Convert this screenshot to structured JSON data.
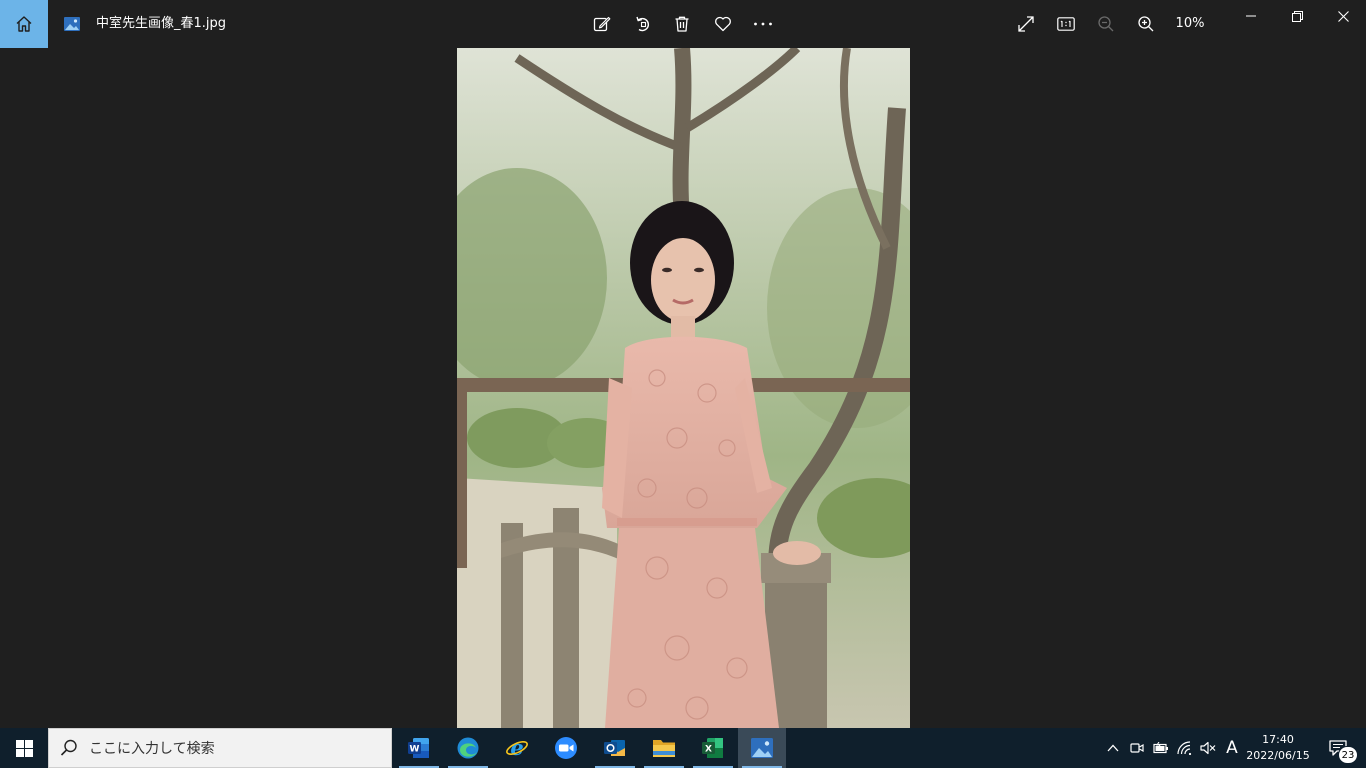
{
  "titlebar": {
    "file_name": "中室先生画像_春1.jpg",
    "zoom_level": "10%"
  },
  "taskbar": {
    "search_placeholder": "ここに入力して検索",
    "clock_time": "17:40",
    "clock_date": "2022/06/15",
    "notification_count": "23",
    "ime_mode": "A"
  },
  "colors": {
    "accent": "#6cb4e8",
    "background": "#1f1f1f",
    "taskbar": "#0f1f2c"
  }
}
